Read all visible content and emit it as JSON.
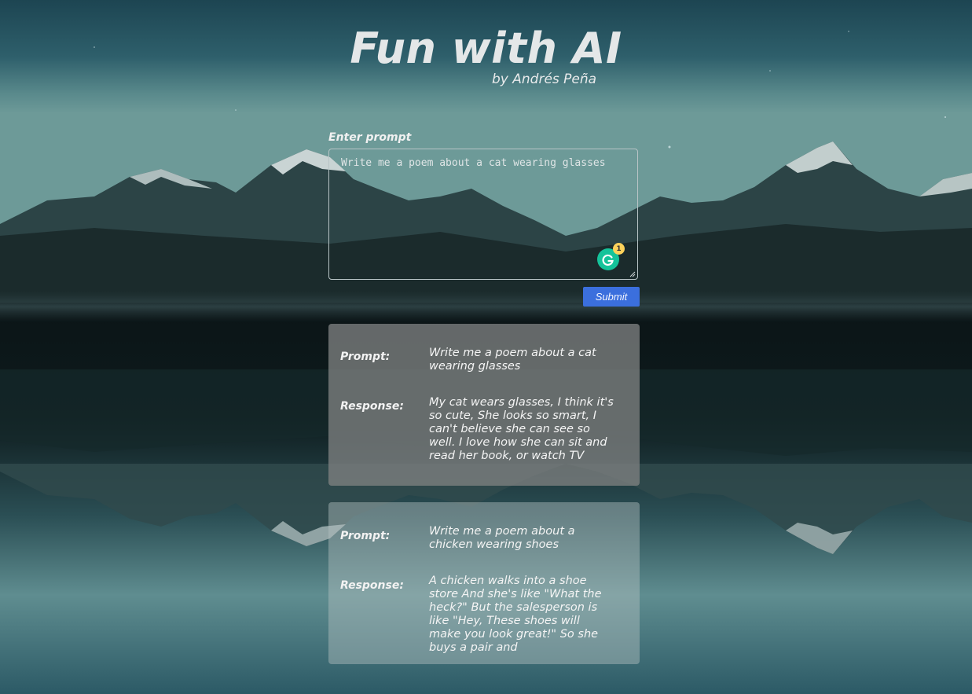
{
  "header": {
    "title": "Fun with AI",
    "author": "by Andrés Peña"
  },
  "prompt_form": {
    "label": "Enter prompt",
    "value": "Write me a poem about a cat wearing glasses",
    "grammarly_count": "1",
    "submit_label": "Submit",
    "accent_color": "#3b6fdd"
  },
  "results": [
    {
      "prompt_label": "Prompt:",
      "prompt": "Write me a poem about a cat wearing glasses",
      "response_label": "Response:",
      "response": "My cat wears glasses, I think it's so cute, She looks so smart, I can't believe she can see so well. I love how she can sit and read her book, or watch TV"
    },
    {
      "prompt_label": "Prompt:",
      "prompt": "Write me a poem about a chicken wearing shoes",
      "response_label": "Response:",
      "response": "A chicken walks into a shoe store And she's like \"What the heck?\" But the salesperson is like \"Hey, These shoes will make you look great!\" So she buys a pair and"
    }
  ],
  "icons": {
    "grammarly": "grammarly-icon",
    "resize": "resize-handle-icon"
  }
}
